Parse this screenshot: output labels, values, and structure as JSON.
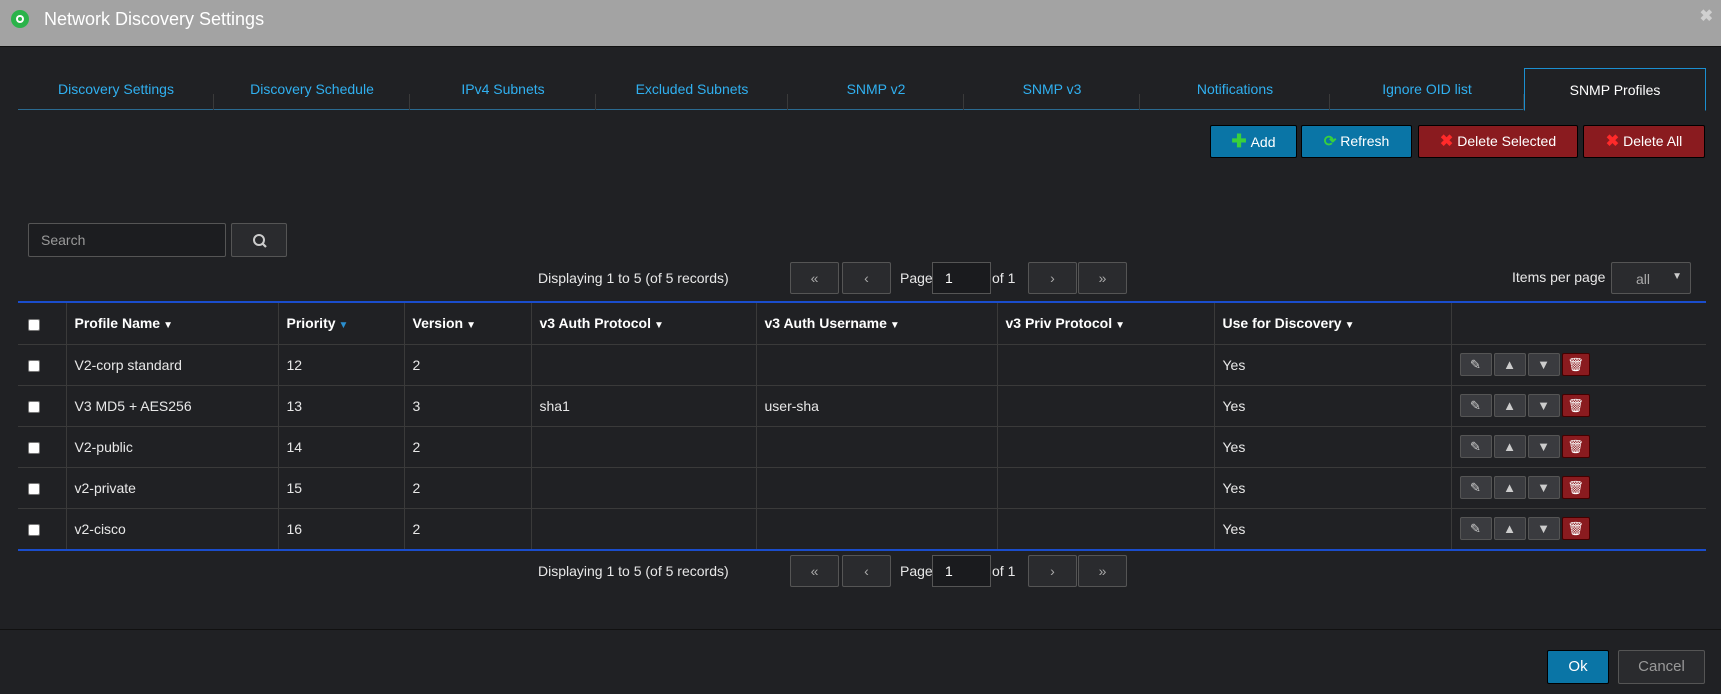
{
  "window": {
    "title": "Network Discovery Settings",
    "close_glyph": "✖"
  },
  "tabs": [
    {
      "label": "Discovery Settings"
    },
    {
      "label": "Discovery Schedule"
    },
    {
      "label": "IPv4 Subnets"
    },
    {
      "label": "Excluded Subnets"
    },
    {
      "label": "SNMP v2"
    },
    {
      "label": "SNMP v3"
    },
    {
      "label": "Notifications"
    },
    {
      "label": "Ignore OID list"
    },
    {
      "label": "SNMP Profiles",
      "active": true
    }
  ],
  "toolbar": {
    "add_label": "Add",
    "refresh_label": "Refresh",
    "delete_selected_label": "Delete Selected",
    "delete_all_label": "Delete All"
  },
  "search": {
    "placeholder": "Search"
  },
  "pager": {
    "display_text": "Displaying 1 to 5 (of 5 records)",
    "page_label": "Page",
    "page_value": "1",
    "of_label": "of 1",
    "first_glyph": "«",
    "prev_glyph": "‹",
    "next_glyph": "›",
    "last_glyph": "»"
  },
  "items_per_page": {
    "label": "Items per page",
    "value": "all"
  },
  "table": {
    "columns": [
      "Profile Name",
      "Priority",
      "Version",
      "v3 Auth Protocol",
      "v3 Auth Username",
      "v3 Priv Protocol",
      "Use for Discovery"
    ],
    "rows": [
      {
        "profile_name": "V2-corp standard",
        "priority": "12",
        "version": "2",
        "auth_protocol": "",
        "auth_username": "",
        "priv_protocol": "",
        "use_for_discovery": "Yes"
      },
      {
        "profile_name": "V3 MD5 + AES256",
        "priority": "13",
        "version": "3",
        "auth_protocol": "sha1",
        "auth_username": "user-sha",
        "priv_protocol": "",
        "use_for_discovery": "Yes"
      },
      {
        "profile_name": "V2-public",
        "priority": "14",
        "version": "2",
        "auth_protocol": "",
        "auth_username": "",
        "priv_protocol": "",
        "use_for_discovery": "Yes"
      },
      {
        "profile_name": "v2-private",
        "priority": "15",
        "version": "2",
        "auth_protocol": "",
        "auth_username": "",
        "priv_protocol": "",
        "use_for_discovery": "Yes"
      },
      {
        "profile_name": "v2-cisco",
        "priority": "16",
        "version": "2",
        "auth_protocol": "",
        "auth_username": "",
        "priv_protocol": "",
        "use_for_discovery": "Yes"
      }
    ]
  },
  "footer": {
    "ok_label": "Ok",
    "cancel_label": "Cancel"
  },
  "colors": {
    "accent": "#30b0f0",
    "primary_button": "#0a75a6",
    "danger_button": "#8a1b1f",
    "grid_border": "#1a4dcc"
  }
}
